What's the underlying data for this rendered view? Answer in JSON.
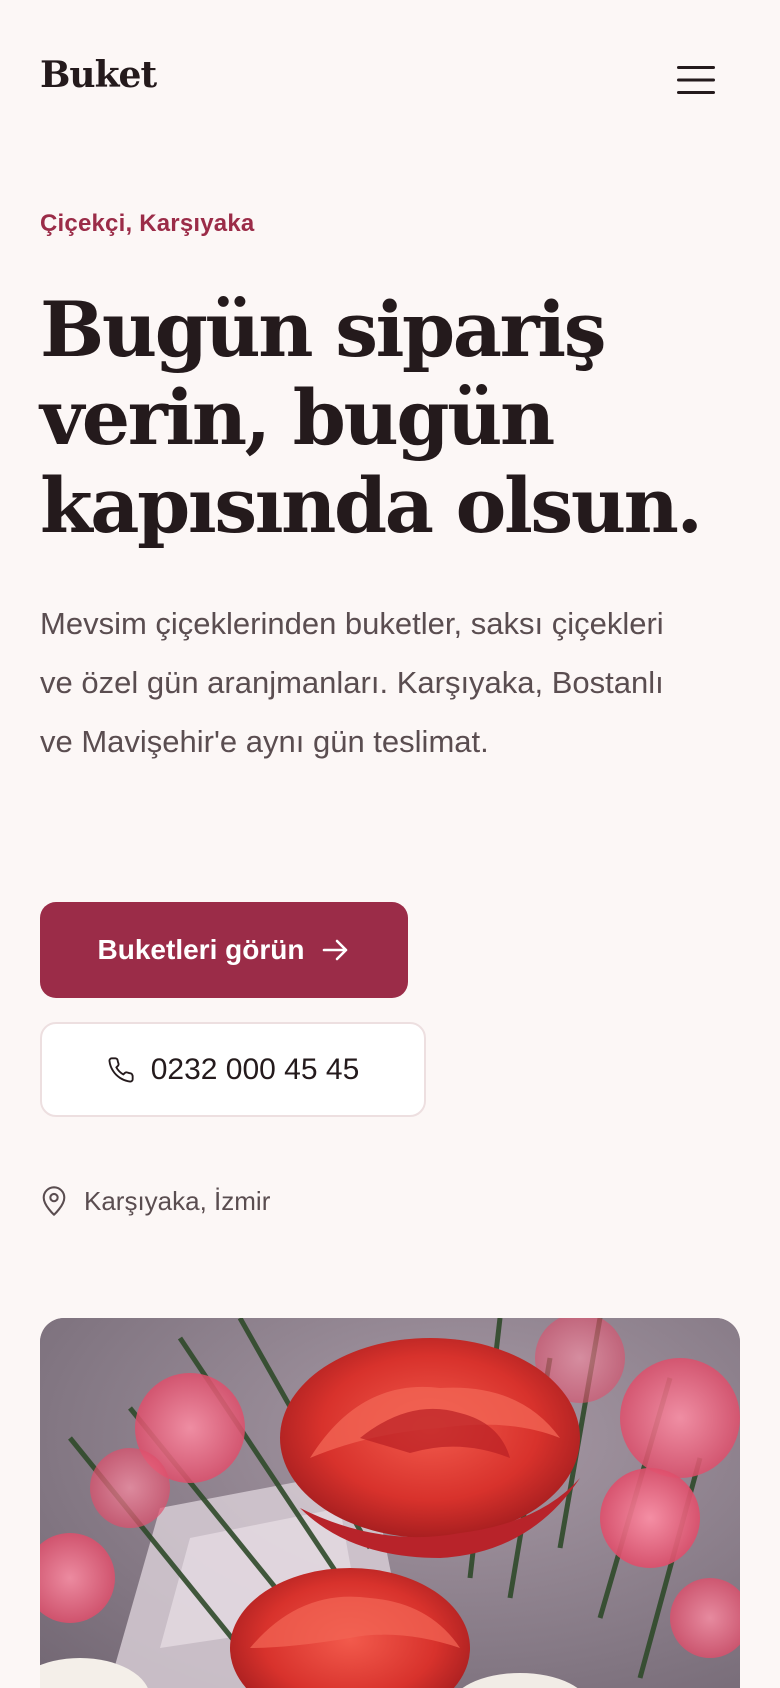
{
  "brand": {
    "logo": "Buket"
  },
  "header": {
    "menu_icon": "hamburger-menu-icon"
  },
  "hero": {
    "eyebrow": "Çiçekçi, Karşıyaka",
    "headline": "Bugün sipariş verin, bugün kapısında olsun.",
    "lead": "Mevsim çiçeklerinden buketler, saksı çiçekleri ve özel gün aranjmanları. Karşıyaka, Bostanlı ve Mavişehir'e aynı gün teslimat.",
    "primary_cta": {
      "label": "Buketleri görün",
      "icon": "arrow-right-icon"
    },
    "phone_cta": {
      "label": "0232 000 45 45",
      "icon": "phone-icon"
    },
    "location": {
      "label": "Karşıyaka, İzmir",
      "icon": "map-pin-icon"
    },
    "image": {
      "subject": "red-roses-bouquet"
    }
  },
  "colors": {
    "background": "#fcf7f6",
    "accent": "#9b2c48",
    "text": "#241a1c",
    "muted_text": "#5a4d50"
  }
}
